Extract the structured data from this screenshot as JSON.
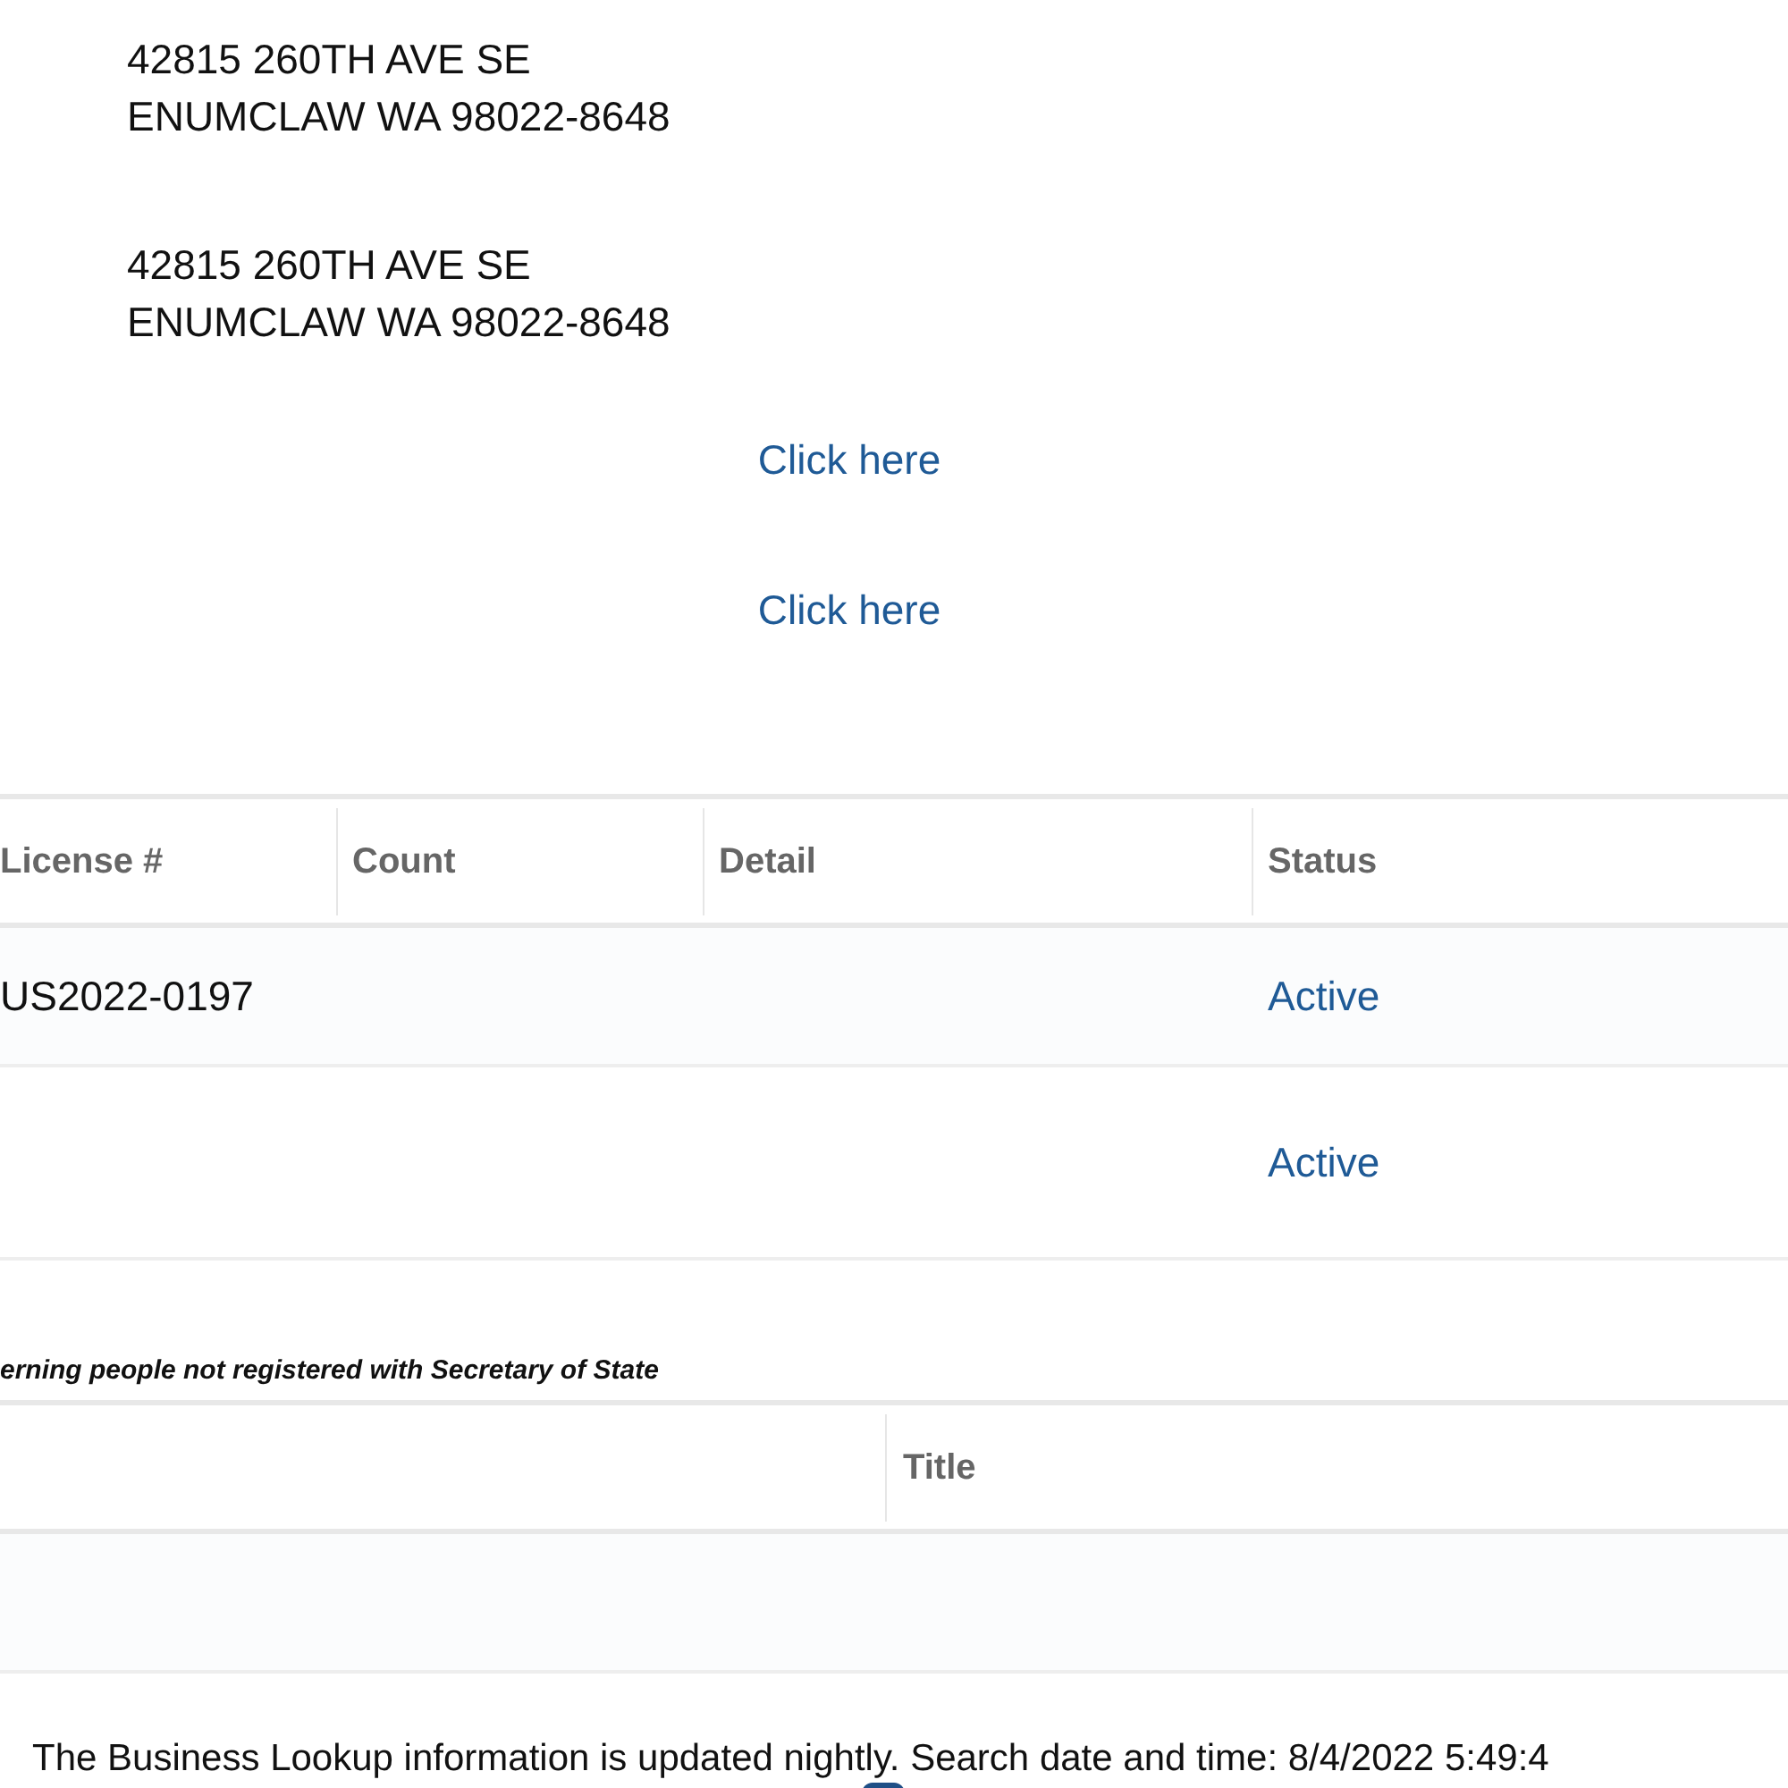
{
  "addresses": [
    {
      "lines": [
        "42815 260TH AVE SE",
        "ENUMCLAW WA 98022-8648"
      ]
    },
    {
      "lines": [
        "42815 260TH AVE SE",
        "ENUMCLAW WA 98022-8648"
      ]
    }
  ],
  "links": [
    "Click here",
    "Click here"
  ],
  "license_table": {
    "columns": [
      "License #",
      "Count",
      "Detail",
      "Status"
    ],
    "rows": [
      {
        "cells": [
          "US2022-0197",
          "",
          "",
          "Active"
        ]
      },
      {
        "cells": [
          "",
          "",
          "",
          "Active"
        ]
      }
    ]
  },
  "governing_caption": "erning people not registered with Secretary of State",
  "governing_table": {
    "columns": [
      "",
      "Title"
    ],
    "rows": [
      {
        "cells": [
          "",
          ""
        ]
      }
    ]
  },
  "footer_note": "The Business Lookup information is updated nightly. Search date and time: 8/4/2022 5:49:4"
}
